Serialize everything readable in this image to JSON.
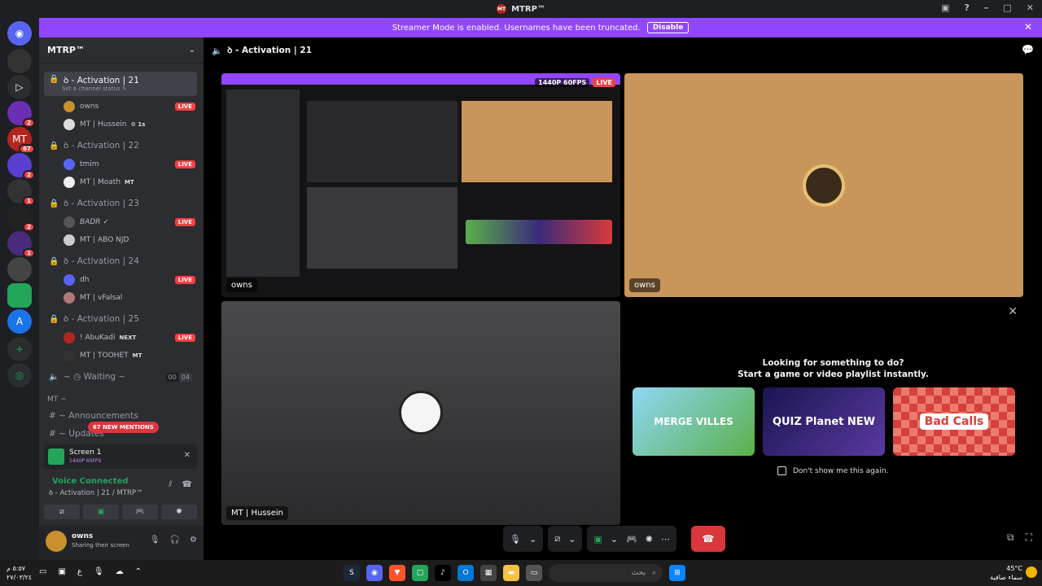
{
  "window": {
    "title": "MTRP™",
    "logo_text": "MT"
  },
  "banner": {
    "text": "Streamer Mode is enabled. Usernames have been truncated.",
    "button": "Disable"
  },
  "servers": [
    {
      "label": "",
      "badge": ""
    },
    {
      "label": "",
      "badge": ""
    },
    {
      "label": "",
      "badge": ""
    },
    {
      "label": "",
      "badge": "2"
    },
    {
      "label": "MT",
      "badge": "67"
    },
    {
      "label": "",
      "badge": "2"
    },
    {
      "label": "",
      "badge": "1"
    },
    {
      "label": "",
      "badge": "2"
    },
    {
      "label": "",
      "badge": "1"
    },
    {
      "label": "",
      "badge": ""
    },
    {
      "label": "",
      "badge": ""
    },
    {
      "label": "A",
      "badge": ""
    }
  ],
  "sidebar": {
    "guild_name": "MTRP™",
    "channels": [
      {
        "name": "ꝺ - Activation | 21",
        "status": "Set a channel status ✎",
        "users": [
          {
            "name": "owns",
            "live": "LIVE",
            "extra": ""
          },
          {
            "name": "MT | Hussein",
            "live": "",
            "extra": "⚙ 1s"
          }
        ]
      },
      {
        "name": "ꝺ - Activation | 22",
        "users": [
          {
            "name": "tmim",
            "live": "LIVE",
            "extra": ""
          },
          {
            "name": "MT | Moath",
            "live": "",
            "extra": "MT"
          }
        ]
      },
      {
        "name": "ꝺ - Activation | 23",
        "users": [
          {
            "name": "BADR ✓",
            "live": "LIVE",
            "extra": ""
          },
          {
            "name": "MT | ABO NJD",
            "live": "",
            "extra": ""
          }
        ]
      },
      {
        "name": "ꝺ - Activation | 24",
        "users": [
          {
            "name": "dh",
            "live": "LIVE",
            "extra": ""
          },
          {
            "name": "MT | vFalsal",
            "live": "",
            "extra": ""
          }
        ]
      },
      {
        "name": "ꝺ - Activation | 25",
        "users": [
          {
            "name": "! AbuKadi",
            "live": "LIVE",
            "extra": "NEXT"
          },
          {
            "name": "MT | TOOHET",
            "live": "",
            "extra": "MT"
          }
        ]
      }
    ],
    "waiting": {
      "label": "~ ◷ Waiting ~",
      "count_a": "00",
      "count_b": "04"
    },
    "category": "MT ~",
    "announcements": "# ~ Announcements",
    "updates": "# ~ Updates",
    "mentions_pill": "67 NEW MENTIONS"
  },
  "screen_panel": {
    "title": "Screen 1",
    "sub": "1440P 60FPS"
  },
  "voice": {
    "status": "Voice Connected",
    "channel": "ꝺ - Activation | 21 / MTRP™"
  },
  "user_panel": {
    "name": "owns",
    "status": "Sharing their screen"
  },
  "main": {
    "channel_title": "ꝺ - Activation | 21",
    "tiles": {
      "stream": {
        "name": "owns",
        "quality": "1440P 60FPS",
        "live": "LIVE"
      },
      "camera": {
        "name": "owns"
      },
      "hussein": {
        "name": "MT | Hussein"
      }
    },
    "activity": {
      "heading1": "Looking for something to do?",
      "heading2": "Start a game or video playlist instantly.",
      "cards": [
        "MERGE VILLES",
        "QUIZ Planet NEW",
        "Bad Calls"
      ],
      "checkbox": "Don't show me this again."
    }
  },
  "taskbar": {
    "date_line1": "٥:٥٧ م",
    "date_line2": "٢٧/٠٣/٢٤",
    "search_placeholder": "بحث",
    "weather_temp": "45°C",
    "weather_desc": "سماء صافية"
  },
  "colors": {
    "accent": "#9146ff",
    "live": "#f23f43",
    "online": "#23a55a",
    "hangup": "#da373c"
  }
}
